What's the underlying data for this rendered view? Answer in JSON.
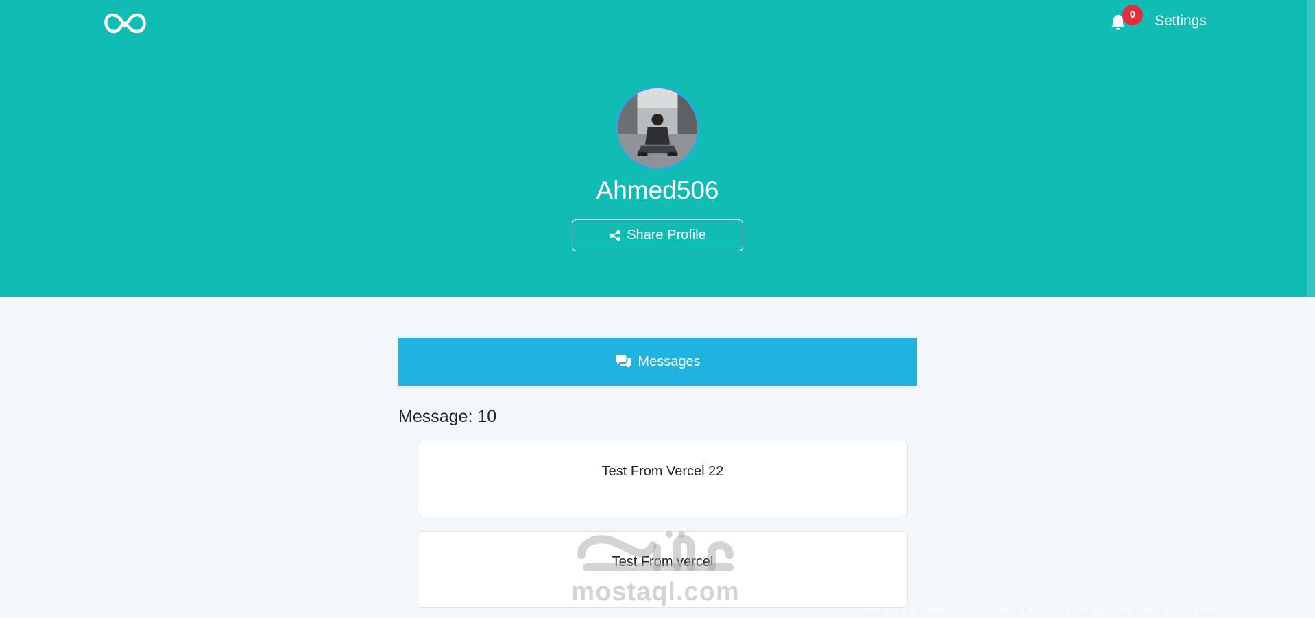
{
  "header": {
    "logo_icon": "infinity-logo-icon",
    "notification_count": "0",
    "settings_label": "Settings"
  },
  "profile": {
    "username": "Ahmed506",
    "share_label": "Share Profile"
  },
  "messages": {
    "tab_label": "Messages",
    "count_label": "Message: 10",
    "items": [
      {
        "text": "Test From Vercel 22"
      },
      {
        "text": "Test From vercel"
      }
    ]
  },
  "watermark": {
    "arabic": "مستقل",
    "latin": "mostaql.com"
  },
  "overlay": {
    "fps": "FPS N/A N/A",
    "gpu": "GPU 0% 45°C 139 MHz 0.675 V 0 W 405 MHz",
    "cpu": "CPU 19%",
    "lat": "LAT N/A N/A"
  },
  "colors": {
    "hero_bg": "#11bcb4",
    "tab_bg": "#1fb3e0",
    "badge_bg": "#e02e3c",
    "page_bg": "#f4f7fa"
  }
}
